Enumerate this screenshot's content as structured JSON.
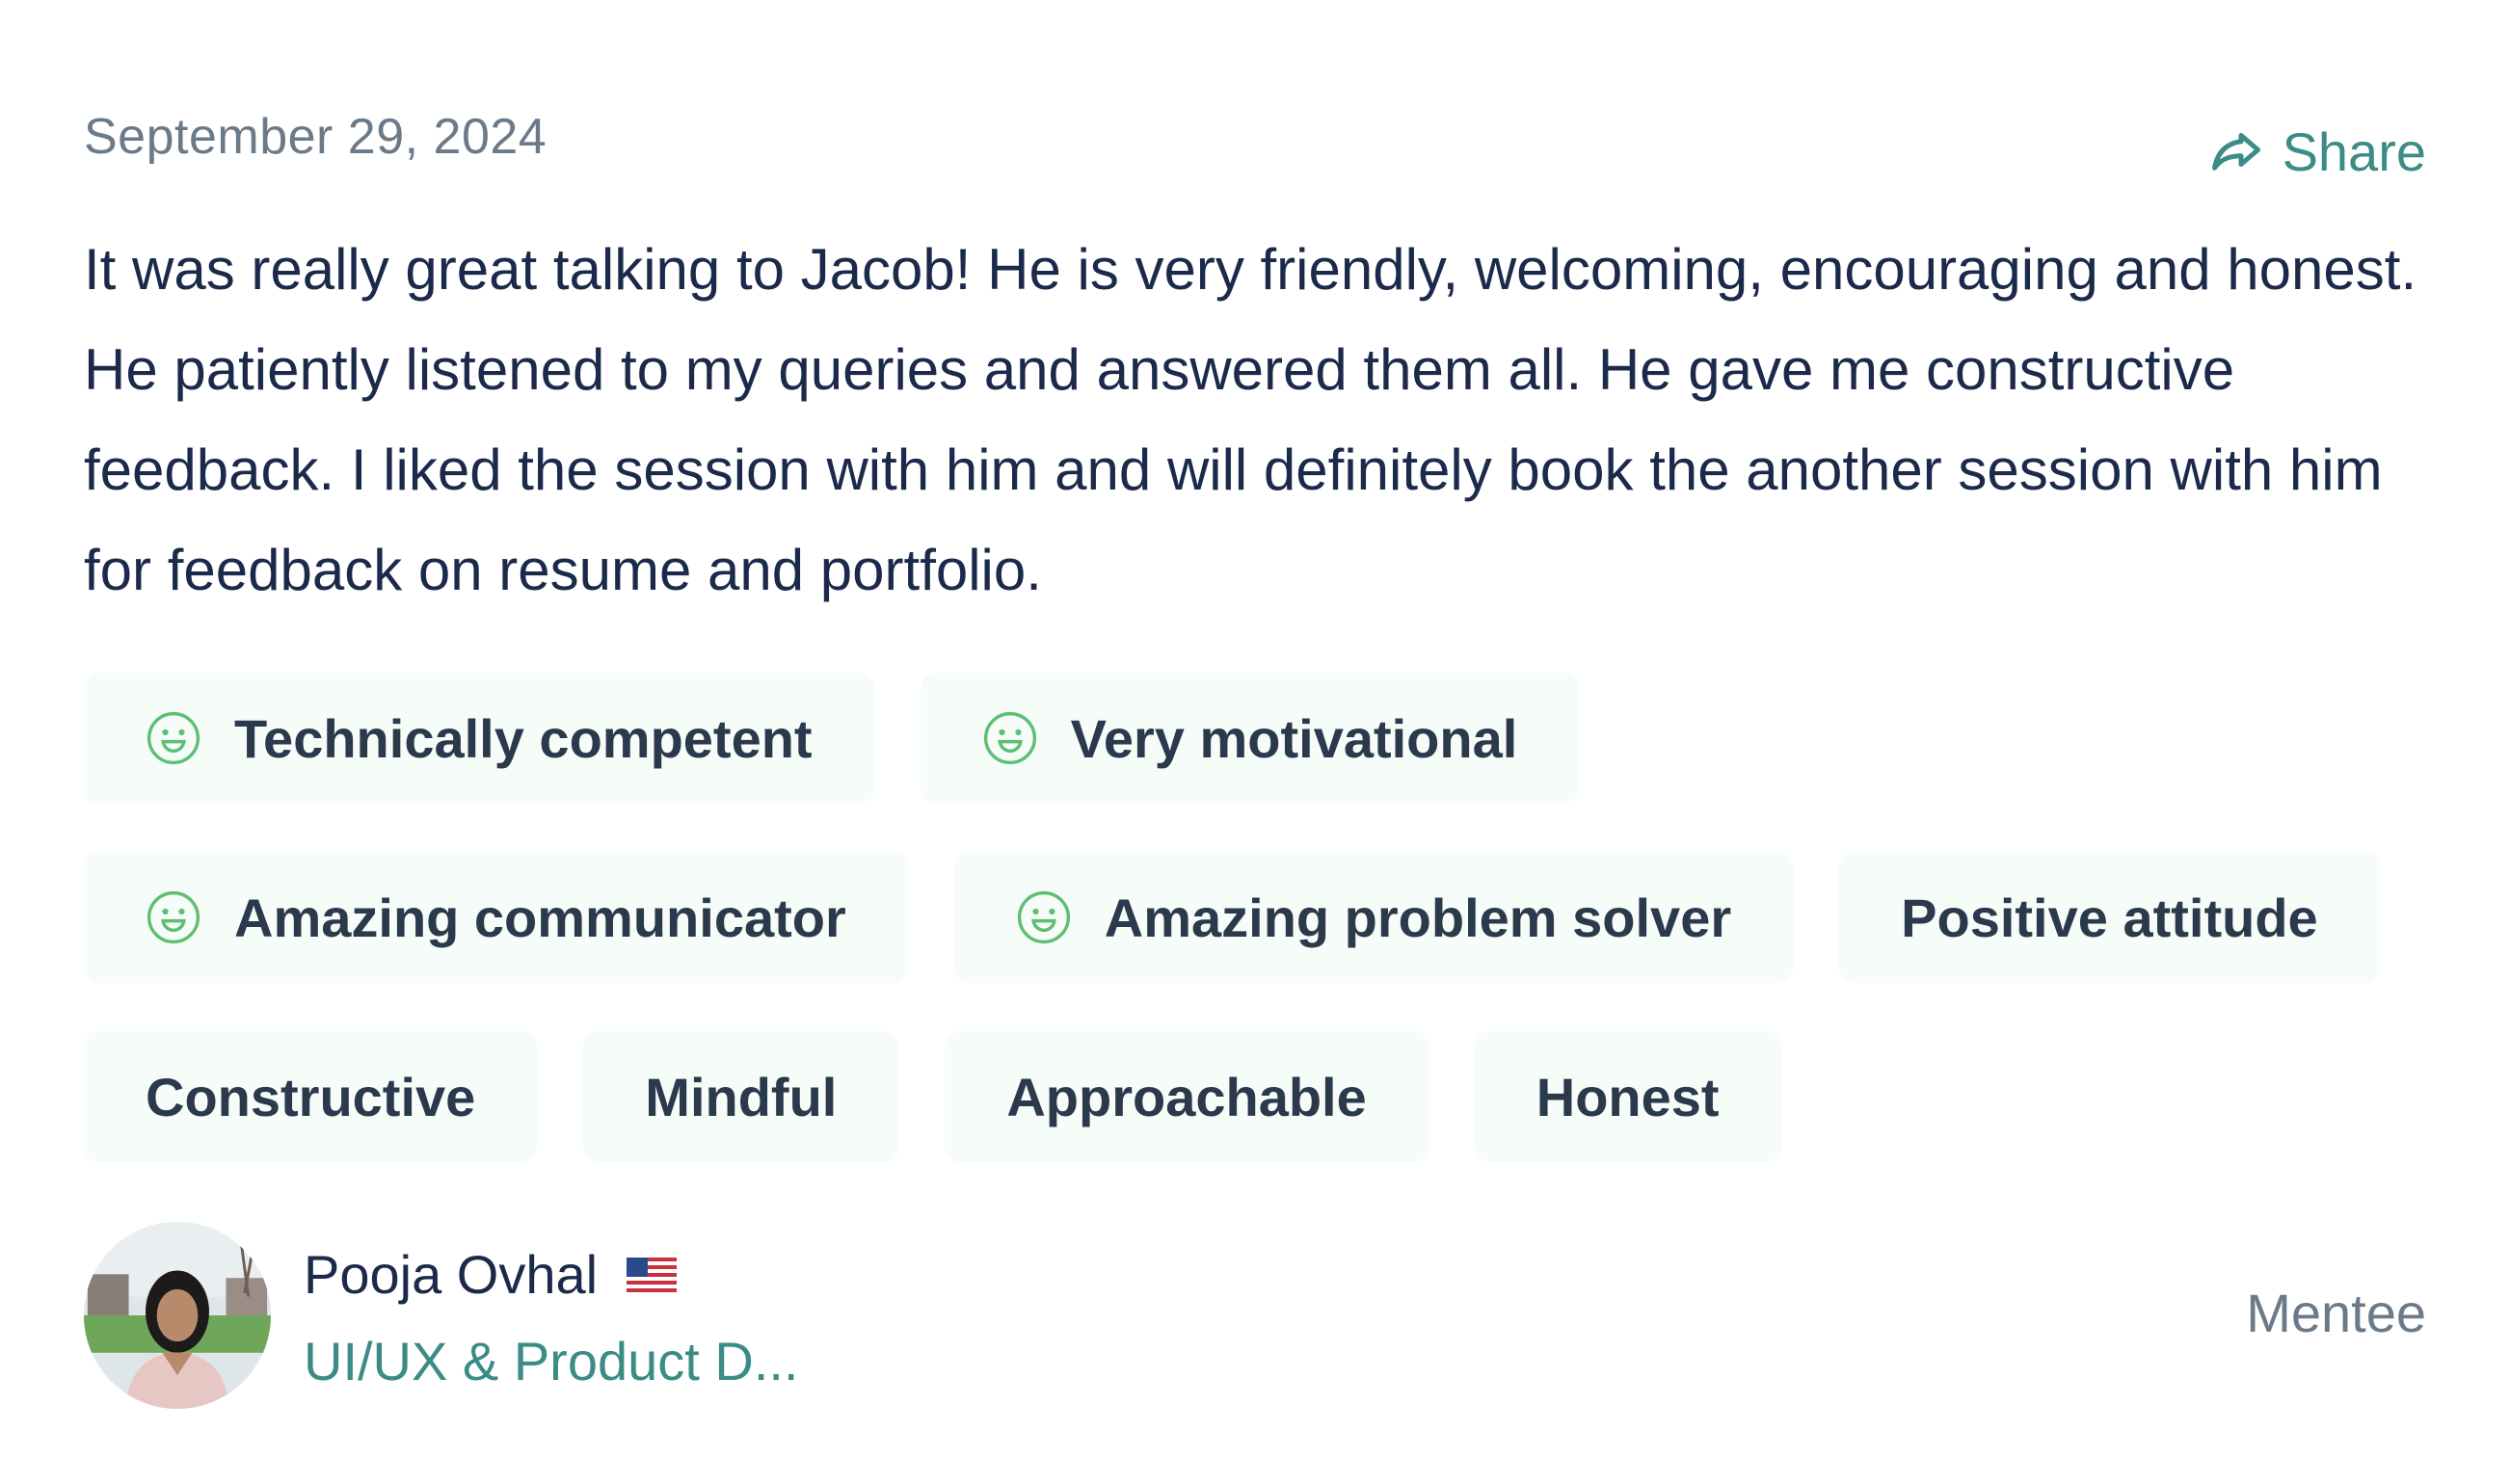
{
  "review": {
    "date": "September 29, 2024",
    "share_label": "Share",
    "text": "It was really great talking to Jacob! He is very friendly, welcoming, encouraging and honest. He patiently listened to my queries and answered them all. He gave me constructive feedback. I liked the session with him and will definitely book the another session with him for feedback on resume and portfolio."
  },
  "tags": {
    "row1": [
      {
        "label": "Technically competent",
        "icon": "smile-icon"
      },
      {
        "label": "Very motivational",
        "icon": "smile-icon"
      }
    ],
    "row2": [
      {
        "label": "Amazing communicator",
        "icon": "smile-icon"
      },
      {
        "label": "Amazing problem solver",
        "icon": "smile-icon"
      },
      {
        "label": "Positive attitude",
        "icon": null
      }
    ],
    "row3": [
      {
        "label": "Constructive",
        "icon": null
      },
      {
        "label": "Mindful",
        "icon": null
      },
      {
        "label": "Approachable",
        "icon": null
      },
      {
        "label": "Honest",
        "icon": null
      }
    ]
  },
  "author": {
    "name": "Pooja Ovhal",
    "flag": "us-flag-icon",
    "headline": "UI/UX & Product D...",
    "role": "Mentee"
  },
  "colors": {
    "accent": "#3b8b86",
    "text": "#1b2a4a",
    "muted": "#6b7a89",
    "tag_bg": "#f6fcf7",
    "smile": "#5cbf73"
  }
}
